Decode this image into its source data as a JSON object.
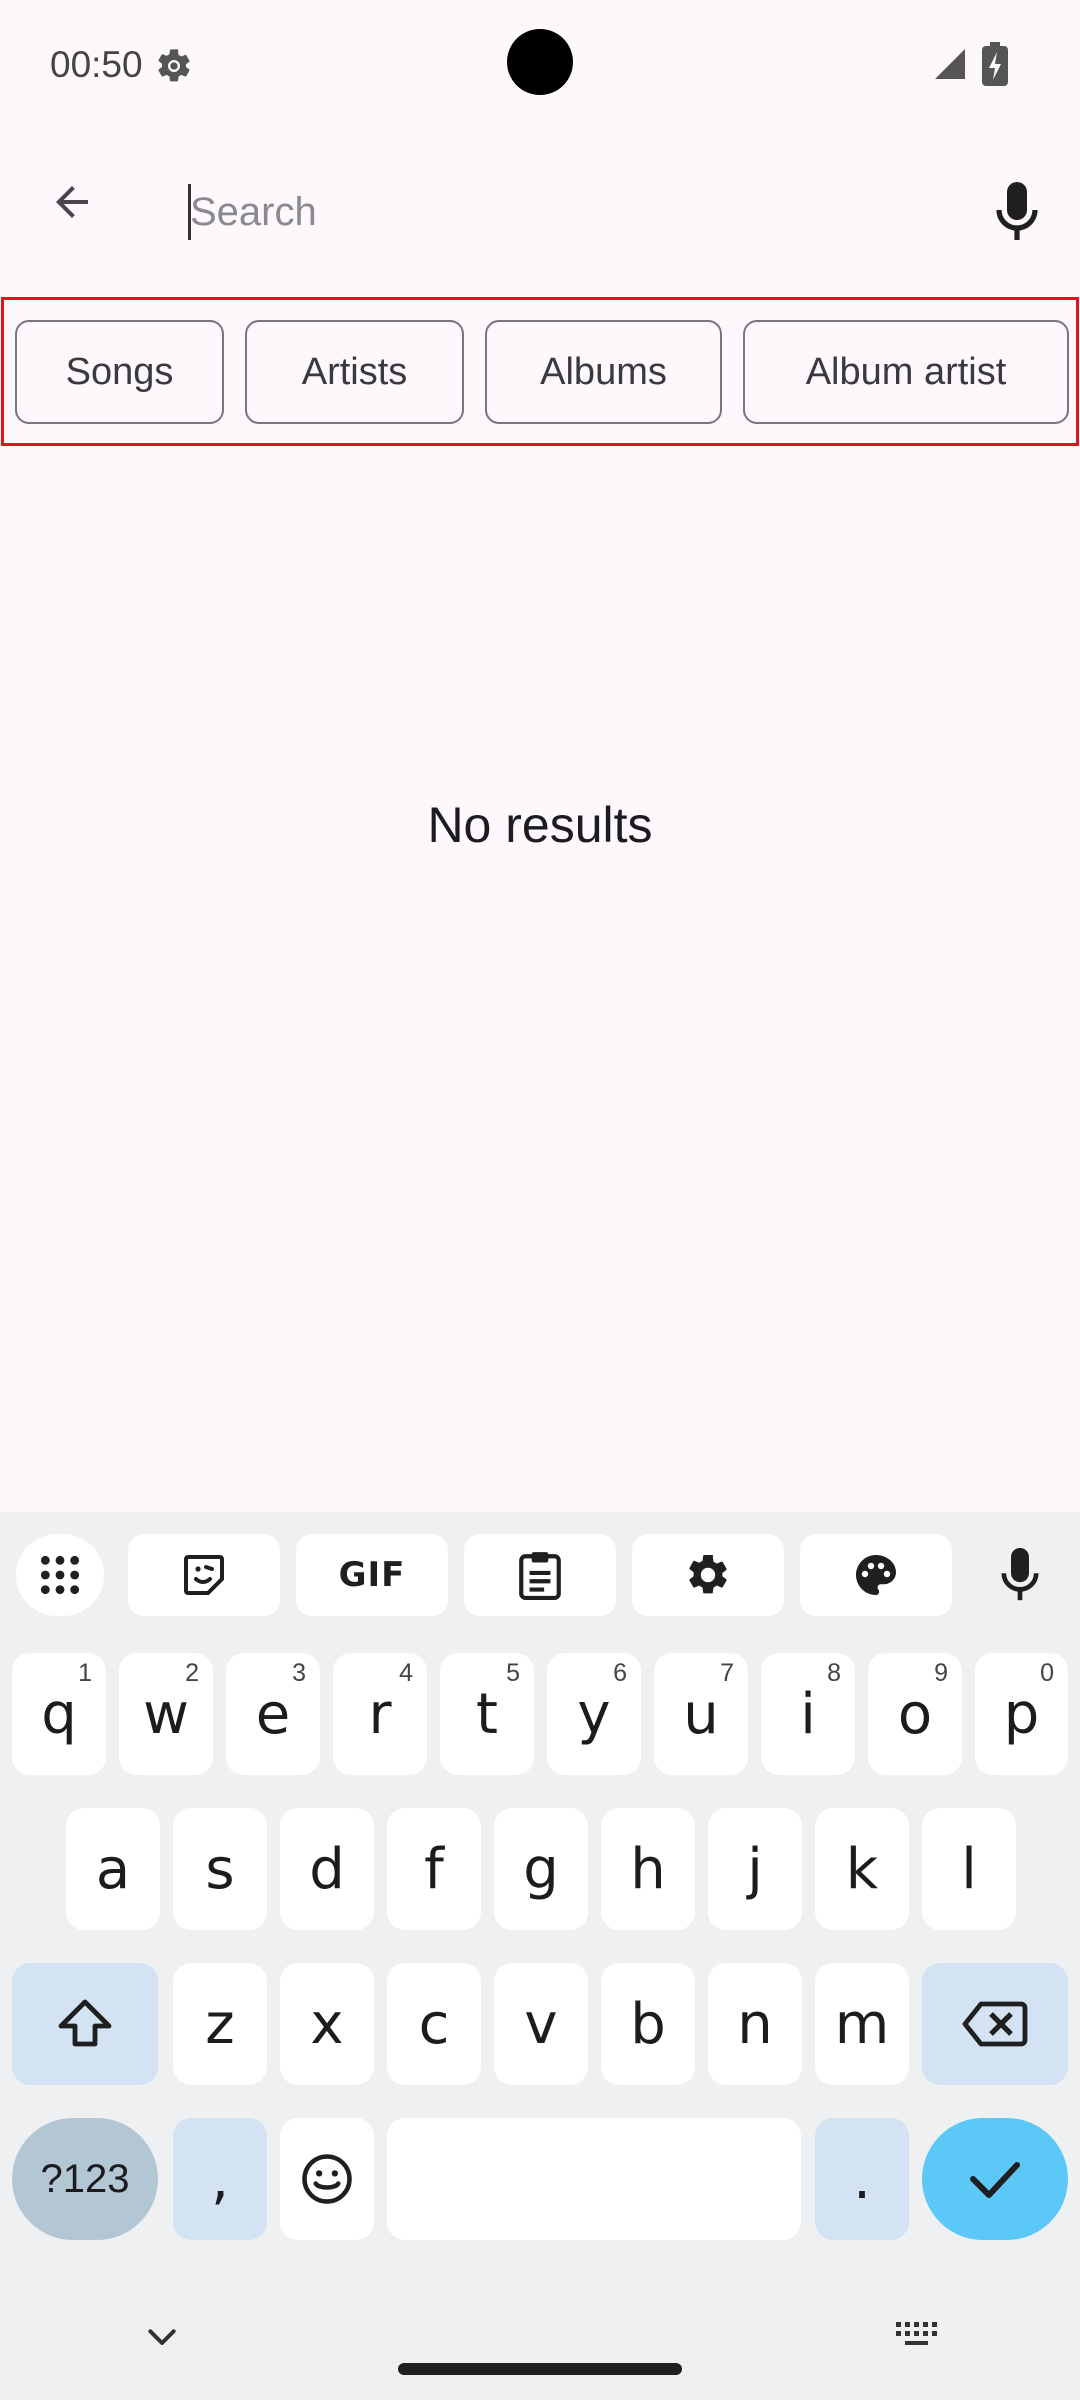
{
  "status_bar": {
    "time": "00:50",
    "icons": [
      "settings-gear-icon",
      "signal-icon",
      "battery-charging-icon"
    ]
  },
  "search": {
    "placeholder": "Search",
    "value": "",
    "back_icon": "arrow-back-icon",
    "mic_icon": "microphone-icon"
  },
  "filters": {
    "chips": [
      {
        "label": "Songs"
      },
      {
        "label": "Artists"
      },
      {
        "label": "Albums"
      },
      {
        "label": "Album artist"
      }
    ]
  },
  "results": {
    "empty_text": "No results"
  },
  "keyboard": {
    "toolbar": [
      "apps-grid-icon",
      "sticker-icon",
      "gif-icon",
      "clipboard-icon",
      "settings-icon",
      "palette-icon",
      "mic-icon"
    ],
    "gif_label": "GIF",
    "row1": [
      {
        "key": "q",
        "hint": "1"
      },
      {
        "key": "w",
        "hint": "2"
      },
      {
        "key": "e",
        "hint": "3"
      },
      {
        "key": "r",
        "hint": "4"
      },
      {
        "key": "t",
        "hint": "5"
      },
      {
        "key": "y",
        "hint": "6"
      },
      {
        "key": "u",
        "hint": "7"
      },
      {
        "key": "i",
        "hint": "8"
      },
      {
        "key": "o",
        "hint": "9"
      },
      {
        "key": "p",
        "hint": "0"
      }
    ],
    "row2": [
      "a",
      "s",
      "d",
      "f",
      "g",
      "h",
      "j",
      "k",
      "l"
    ],
    "row3": [
      "z",
      "x",
      "c",
      "v",
      "b",
      "n",
      "m"
    ],
    "symbols_label": "?123",
    "comma": ",",
    "period": ".",
    "colors": {
      "background": "#eff0f2",
      "key": "#ffffff",
      "function_key": "#d3e3f3",
      "symbols_key": "#b2c7d3",
      "enter_key": "#5cc8f8"
    }
  },
  "highlight_color": "#e0141c"
}
